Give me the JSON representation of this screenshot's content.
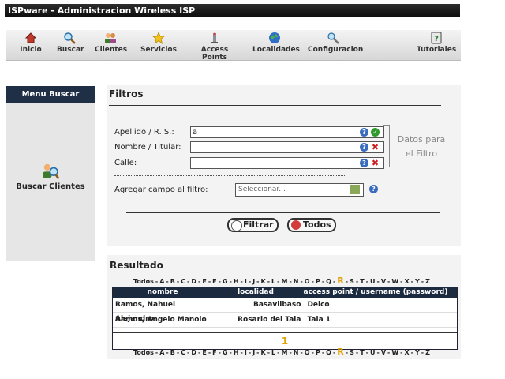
{
  "app": {
    "title": "ISPware - Administracion Wireless ISP"
  },
  "nav": [
    {
      "label": "Inicio",
      "icon": "home-icon"
    },
    {
      "label": "Buscar",
      "icon": "search-icon"
    },
    {
      "label": "Clientes",
      "icon": "users-icon"
    },
    {
      "label": "Servicios",
      "icon": "star-icon"
    },
    {
      "label": "Access Points",
      "icon": "antenna-icon"
    },
    {
      "label": "Localidades",
      "icon": "globe-icon"
    },
    {
      "label": "Configuracion",
      "icon": "tools-icon"
    },
    {
      "label": "Tutoriales",
      "icon": "help-book-icon"
    }
  ],
  "sidebar": {
    "title": "Menu Buscar",
    "item": "Buscar Clientes"
  },
  "filters": {
    "title": "Filtros",
    "fields": [
      {
        "label": "Apellido / R. S.:",
        "value": "a",
        "status": "ok"
      },
      {
        "label": "Nombre / Titular:",
        "value": "",
        "status": "error"
      },
      {
        "label": "Calle:",
        "value": "",
        "status": "error"
      }
    ],
    "side_note": "Datos para el Filtro",
    "add_label": "Agregar campo al filtro:",
    "select_value": "Seleccionar...",
    "filter_button": "Filtrar",
    "all_button": "Todos"
  },
  "result": {
    "title": "Resultado",
    "alphabet_all": "Todos",
    "letters": [
      "A",
      "B",
      "C",
      "D",
      "E",
      "F",
      "G",
      "H",
      "I",
      "J",
      "K",
      "L",
      "M",
      "N",
      "O",
      "P",
      "Q",
      "R",
      "S",
      "T",
      "U",
      "V",
      "W",
      "X",
      "Y",
      "Z"
    ],
    "active_letter": "R",
    "columns": [
      "nombre",
      "localidad",
      "access point / username (password)"
    ],
    "rows": [
      {
        "nombre": "Ramos, Nahuel Alejandro",
        "localidad": "Basavilbaso",
        "ap": "Delco"
      },
      {
        "nombre": "Ramos, Angelo Manolo",
        "localidad": "Rosario del Tala",
        "ap": "Tala 1"
      }
    ],
    "page": "1"
  },
  "colors": {
    "accent": "#1c2a40",
    "active": "#e1a100"
  }
}
